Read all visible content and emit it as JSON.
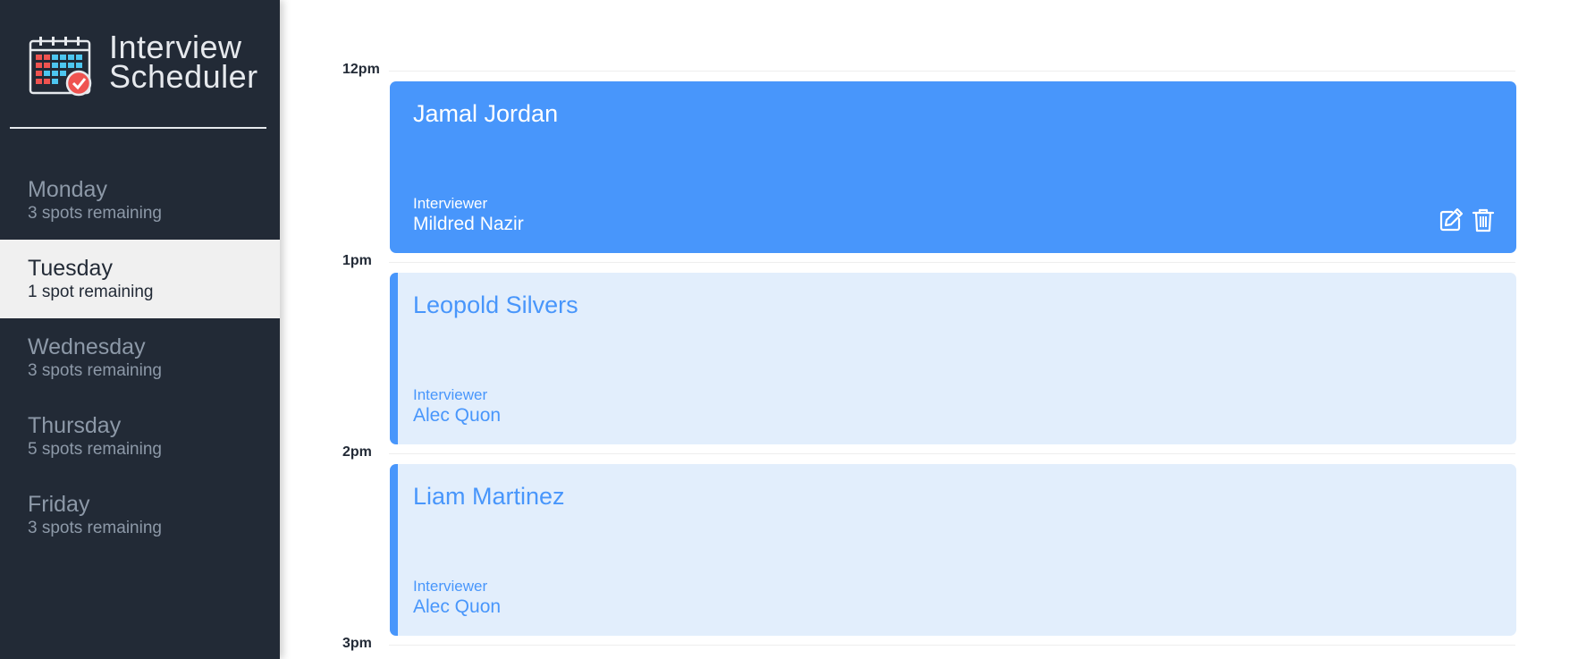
{
  "brand": {
    "line1": "Interview",
    "line2": "Scheduler"
  },
  "days": [
    {
      "name": "Monday",
      "spots": "3 spots remaining",
      "selected": false
    },
    {
      "name": "Tuesday",
      "spots": "1 spot remaining",
      "selected": true
    },
    {
      "name": "Wednesday",
      "spots": "3 spots remaining",
      "selected": false
    },
    {
      "name": "Thursday",
      "spots": "5 spots remaining",
      "selected": false
    },
    {
      "name": "Friday",
      "spots": "3 spots remaining",
      "selected": false
    }
  ],
  "appointments": [
    {
      "time": "12pm",
      "student": "Jamal Jordan",
      "interviewer_label": "Interviewer",
      "interviewer": "Mildred Nazir",
      "state": "active"
    },
    {
      "time": "1pm",
      "student": "Leopold Silvers",
      "interviewer_label": "Interviewer",
      "interviewer": "Alec Quon",
      "state": "passive"
    },
    {
      "time": "2pm",
      "student": "Liam Martinez",
      "interviewer_label": "Interviewer",
      "interviewer": "Alec Quon",
      "state": "passive"
    }
  ],
  "last_time": "3pm",
  "icons": {
    "logo": "calendar-check-icon",
    "edit": "edit-icon",
    "delete": "trash-icon"
  },
  "colors": {
    "sidebar": "#222a36",
    "accent": "#4896fb",
    "passive_card": "#e2eefc",
    "selected_day": "#f0f0f0"
  }
}
